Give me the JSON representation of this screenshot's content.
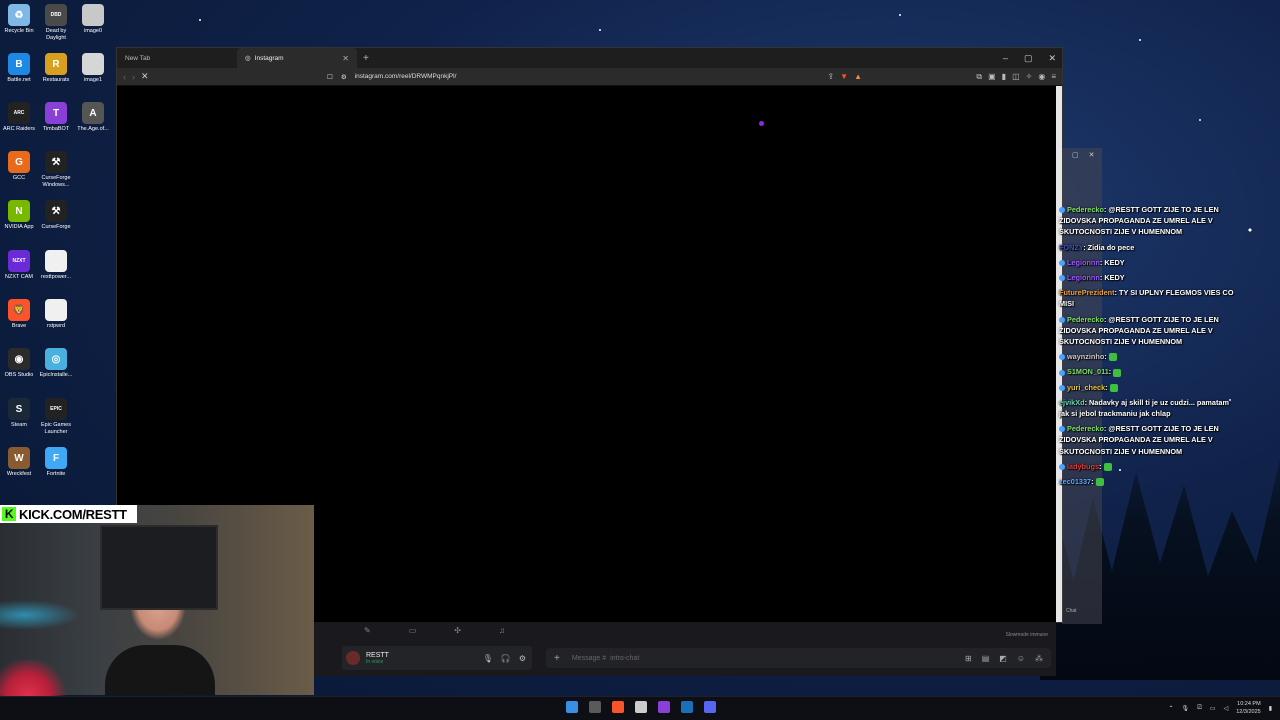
{
  "desktop": {
    "icons": [
      {
        "label": "Recycle Bin",
        "color": "#7fb8e6",
        "glyph": "♻"
      },
      {
        "label": "Dead by Daylight",
        "color": "#4a4a4a",
        "glyph": "DBD"
      },
      {
        "label": "image0",
        "color": "#c8c8c8",
        "glyph": ""
      },
      {
        "label": "Battle.net",
        "color": "#1e88e5",
        "glyph": "B"
      },
      {
        "label": "Restaurats",
        "color": "#d9a020",
        "glyph": "R"
      },
      {
        "label": "image1",
        "color": "#d6d6d6",
        "glyph": ""
      },
      {
        "label": "ARC Raiders",
        "color": "#222",
        "glyph": "ARC"
      },
      {
        "label": "TimbaBOT",
        "color": "#8a3fd6",
        "glyph": "T"
      },
      {
        "label": "The.Age.of...",
        "color": "#555",
        "glyph": "A"
      },
      {
        "label": "GCC",
        "color": "#e86a1a",
        "glyph": "G"
      },
      {
        "label": "CurseForge Windows...",
        "color": "#222",
        "glyph": "⚒"
      },
      {
        "label": "NVIDIA App",
        "color": "#76b900",
        "glyph": "N"
      },
      {
        "label": "CurseForge",
        "color": "#222",
        "glyph": "⚒"
      },
      {
        "label": "NZXT CAM",
        "color": "#6a2ad6",
        "glyph": "NZXT"
      },
      {
        "label": "resttpower...",
        "color": "#f0f0f0",
        "glyph": ""
      },
      {
        "label": "Brave",
        "color": "#fb542b",
        "glyph": "🦁"
      },
      {
        "label": "rstpwrd",
        "color": "#f0f0f0",
        "glyph": ""
      },
      {
        "label": "OBS Studio",
        "color": "#2b2b2b",
        "glyph": "◉"
      },
      {
        "label": "EpicInstalle...",
        "color": "#4ab0e0",
        "glyph": "◎"
      },
      {
        "label": "Steam",
        "color": "#1b2838",
        "glyph": "S"
      },
      {
        "label": "Epic Games Launcher",
        "color": "#222",
        "glyph": "EPIC"
      },
      {
        "label": "Wreckfest",
        "color": "#8a5a30",
        "glyph": "W"
      },
      {
        "label": "Fortnite",
        "color": "#3fa9f5",
        "glyph": "F"
      }
    ]
  },
  "browser": {
    "tabs": [
      {
        "label": "New Tab",
        "active": false
      },
      {
        "label": "Instagram",
        "active": true
      }
    ],
    "url": "instagram.com/reel/DRWMPqnkjPl/",
    "window_controls": [
      "minimize",
      "maximize",
      "close"
    ]
  },
  "discord": {
    "username": "RESTT",
    "status": "In voice",
    "message_placeholder": "Message #",
    "channel": "intro-chat",
    "slowmode_text": "Slowmode immune"
  },
  "chat_overlay": {
    "footer_label": "Chat",
    "messages": [
      {
        "user": "Pederecko",
        "user_color": "#7ee06a",
        "text": "@RESTT GOTT ZIJE TO JE LEN ZIDOVSKA PROPAGANDA ZE UMREL ALE V SKUTOCNOSTI ZIJE V HUMENNOM",
        "badge": true
      },
      {
        "user": "FONZY",
        "user_color": "#3f51b5",
        "text": "Zidia do pece",
        "badge": false
      },
      {
        "user": "Legionnn",
        "user_color": "#9b59ff",
        "text": "KEDY",
        "badge": true
      },
      {
        "user": "Legionnn",
        "user_color": "#9b59ff",
        "text": "KEDY",
        "badge": true
      },
      {
        "user": "FuturePrezident",
        "user_color": "#e8a23a",
        "text": "TY SI UPLNY FLEGMOS VIES CO MISI",
        "badge": false
      },
      {
        "user": "Pederecko",
        "user_color": "#7ee06a",
        "text": "@RESTT GOTT ZIJE TO JE LEN ZIDOVSKA PROPAGANDA ZE UMREL ALE V SKUTOCNOSTI ZIJE V HUMENNOM",
        "badge": true
      },
      {
        "user": "waynzinho",
        "user_color": "#c9c9c9",
        "text": "",
        "badge": true
      },
      {
        "user": "S1MON_011",
        "user_color": "#7ee06a",
        "text": "",
        "badge": true
      },
      {
        "user": "yuri_check",
        "user_color": "#e6c440",
        "text": "",
        "badge": true
      },
      {
        "user": "ejvikXd",
        "user_color": "#6ad6b0",
        "text": "Nadavky aj skill ti je uz cudzi... pamatam jak si jebol trackmaniu jak chlap",
        "badge": false
      },
      {
        "user": "Pederecko",
        "user_color": "#7ee06a",
        "text": "@RESTT GOTT ZIJE TO JE LEN ZIDOVSKA PROPAGANDA ZE UMREL ALE V SKUTOCNOSTI ZIJE V HUMENNOM",
        "badge": true
      },
      {
        "user": "ladybugs",
        "user_color": "#e03a3a",
        "text": "",
        "badge": true
      },
      {
        "user": "zec01337",
        "user_color": "#5aa8ff",
        "text": "",
        "badge": false
      }
    ]
  },
  "webcam": {
    "kick_label": "KICK.COM/RESTT",
    "kick_logo": "K"
  },
  "taskbar": {
    "time": "10:24 PM",
    "date": "12/3/2025",
    "center_icons": [
      "windows-start-icon",
      "xbox-icon",
      "brave-icon",
      "chrome-icon",
      "timbabot-icon",
      "steam-icon",
      "discord-icon"
    ]
  }
}
